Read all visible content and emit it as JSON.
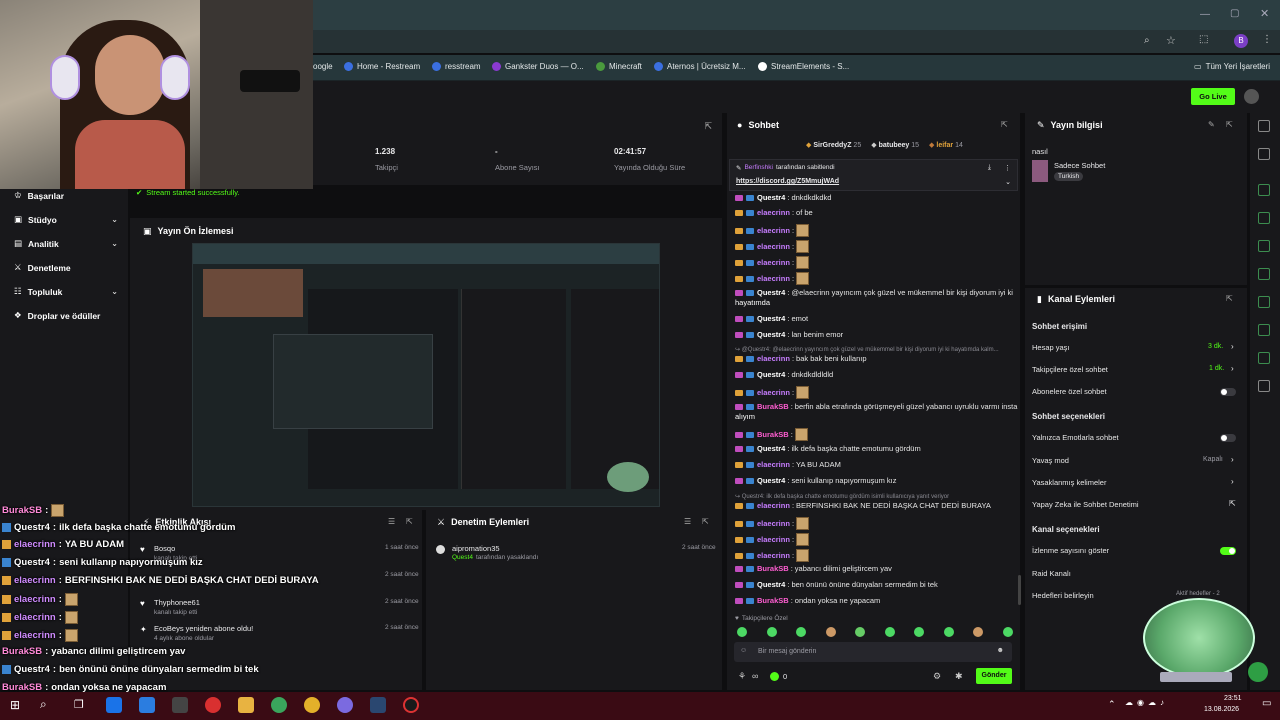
{
  "bookmarks": [
    {
      "label": "oogle",
      "color": "#888"
    },
    {
      "label": "Home - Restream",
      "color": "#3b6fe0"
    },
    {
      "label": "resstream",
      "color": "#3b6fe0"
    },
    {
      "label": "Gankster Duos — O...",
      "color": "#8a3ad1"
    },
    {
      "label": "Minecraft",
      "color": "#4a9a3d"
    },
    {
      "label": "Aternos | Ücretsiz M...",
      "color": "#3b6fe0"
    },
    {
      "label": "StreamElements - S...",
      "color": "#ffffff"
    }
  ],
  "all_bookmarks": "Tüm Yeri İşaretleri",
  "go_live": "Go Live",
  "stats": [
    {
      "value": "1.238",
      "label": "Takipçi"
    },
    {
      "value": "-",
      "label": "Abone Sayısı"
    },
    {
      "value": "02:41:57",
      "label": "Yayında Olduğu Süre"
    }
  ],
  "stream_status": "Stream started successfully.",
  "nav": [
    "Başarılar",
    "Stüdyo",
    "Analitik",
    "Denetleme",
    "Topluluk",
    "Droplar ve ödüller"
  ],
  "preview_title": "Yayın Ön İzlemesi",
  "activity": {
    "title": "Etkinlik Akışı",
    "items": [
      {
        "name": "Bosqo",
        "sub": "kanalı takip etti",
        "time": "1 saat önce"
      },
      {
        "name": "",
        "sub": "",
        "time": "2 saat önce"
      },
      {
        "name": "Thyphonee61",
        "sub": "kanalı takip etti",
        "time": "2 saat önce"
      },
      {
        "name": "EcoBeys yeniden abone oldu!",
        "sub": "4 aylık abone oldular",
        "time": "2 saat önce"
      }
    ]
  },
  "moderation": {
    "title": "Denetim Eylemleri",
    "item_name": "aipromation35",
    "item_by": "Quest4",
    "item_action": "tarafından yasaklandı",
    "item_time": "2 saat önce"
  },
  "chat": {
    "title": "Sohbet",
    "leaders": [
      {
        "name": "SirGreddyZ",
        "score": "25"
      },
      {
        "name": "batubeey",
        "score": "15"
      },
      {
        "name": "leifar",
        "score": "14"
      }
    ],
    "pinned_by": "Berfinshki",
    "pinned_suffix": "tarafından sabitlendi",
    "pinned_link": "https://discord.gg/Z5MmujWAd",
    "messages": [
      {
        "user": "Questr4",
        "text": "dnkdkdkdkd",
        "color": "#fff",
        "badge": "p"
      },
      {
        "user": "elaecrinn",
        "text": "of be",
        "color": "#c77dff",
        "badge": "c"
      },
      {
        "user": "elaecrinn",
        "text": "",
        "emote": true,
        "color": "#c77dff",
        "badge": "c"
      },
      {
        "user": "elaecrinn",
        "text": "",
        "emote": true,
        "color": "#c77dff",
        "badge": "c"
      },
      {
        "user": "elaecrinn",
        "text": "",
        "emote": true,
        "color": "#c77dff",
        "badge": "c"
      },
      {
        "user": "elaecrinn",
        "text": "",
        "emote": true,
        "color": "#c77dff",
        "badge": "c"
      },
      {
        "user": "Questr4",
        "text": "@elaecrinn yayıncım çok güzel ve mükemmel bir kişi diyorum iyi ki",
        "color": "#fff",
        "badge": "p"
      },
      {
        "user": "",
        "text": "hayatımda",
        "color": "#fff",
        "badge": ""
      },
      {
        "user": "Questr4",
        "text": "emot",
        "color": "#fff",
        "badge": "p"
      },
      {
        "user": "Questr4",
        "text": "lan benim emor",
        "color": "#fff",
        "badge": "p"
      },
      {
        "user": "",
        "text": "↪ @Questr4: @elaecrinn yayıncım çok güzel ve mükemmel bir kişi diyorum iyi ki hayatımda kalm...",
        "color": "#8a8a92",
        "badge": ""
      },
      {
        "user": "elaecrinn",
        "text": "bak bak beni kullanıp",
        "color": "#c77dff",
        "badge": "c"
      },
      {
        "user": "Questr4",
        "text": "dnkdkdldldld",
        "color": "#fff",
        "badge": "p"
      },
      {
        "user": "elaecrinn",
        "text": "",
        "emote": true,
        "color": "#c77dff",
        "badge": "c"
      },
      {
        "user": "BurakSB",
        "text": "berfin abla etrafında görüşmeyeli güzel yabancı uyruklu varmı insta",
        "color": "#ff5ed2",
        "badge": "p"
      },
      {
        "user": "",
        "text": "alıyım",
        "color": "#fff",
        "badge": ""
      },
      {
        "user": "BurakSB",
        "text": "",
        "emote": true,
        "color": "#ff5ed2",
        "badge": "p"
      },
      {
        "user": "Questr4",
        "text": "ilk defa başka chatte emotumu gördüm",
        "color": "#fff",
        "badge": "p"
      },
      {
        "user": "elaecrinn",
        "text": "YA BU ADAM",
        "color": "#c77dff",
        "badge": "c"
      },
      {
        "user": "Questr4",
        "text": "seni kullanıp napıyormuşum kız",
        "color": "#fff",
        "badge": "p"
      },
      {
        "user": "",
        "text": "↪ Questr4: ilk defa başka chatte emotumu gördüm isimli kullanıcıya yanıt veriyor",
        "color": "#8a8a92",
        "badge": ""
      },
      {
        "user": "elaecrinn",
        "text": "BERFINSHKI BAK NE DEDİ BAŞKA CHAT DEDİ BURAYA",
        "color": "#c77dff",
        "badge": "c"
      },
      {
        "user": "elaecrinn",
        "text": "",
        "emote": true,
        "color": "#c77dff",
        "badge": "c"
      },
      {
        "user": "elaecrinn",
        "text": "",
        "emote": true,
        "color": "#c77dff",
        "badge": "c"
      },
      {
        "user": "elaecrinn",
        "text": "",
        "emote": true,
        "color": "#c77dff",
        "badge": "c"
      },
      {
        "user": "BurakSB",
        "text": "yabancı dilimi geliştircem yav",
        "color": "#ff5ed2",
        "badge": "p"
      },
      {
        "user": "Questr4",
        "text": "ben önünü önüne dünyaları sermedim bi tek",
        "color": "#fff",
        "badge": "p"
      },
      {
        "user": "BurakSB",
        "text": "ondan yoksa ne yapacam",
        "color": "#ff5ed2",
        "badge": "p"
      }
    ],
    "followers_only": "Takipçilere Özel",
    "placeholder": "Bir mesaj gönderin",
    "points": "0",
    "send": "Gönder"
  },
  "stream_info": {
    "title": "Yayın bilgisi",
    "name": "nasıl",
    "category": "Sadece Sohbet",
    "tag": "Turkish"
  },
  "channel_actions": {
    "title": "Kanal Eylemleri",
    "section1": "Sohbet erişimi",
    "rows1": [
      {
        "label": "Hesap yaşı",
        "value": "3 dk."
      },
      {
        "label": "Takipçilere özel sohbet",
        "value": "1 dk."
      },
      {
        "label": "Abonelere özel sohbet",
        "value": ""
      }
    ],
    "section2": "Sohbet seçenekleri",
    "rows2": [
      {
        "label": "Yalnızca Emotlarla sohbet",
        "value": ""
      },
      {
        "label": "Yavaş mod",
        "value": "Kapalı"
      },
      {
        "label": "Yasaklanmış kelimeler",
        "value": ""
      },
      {
        "label": "Yapay Zeka ile Sohbet Denetimi",
        "value": ""
      }
    ],
    "section3": "Kanal seçenekleri",
    "rows3": [
      {
        "label": "İzlenme sayısını göster",
        "value": ""
      },
      {
        "label": "Raid Kanalı",
        "value": ""
      },
      {
        "label": "Hedefleri belirleyin",
        "value": "Aktif hedefler - 2"
      }
    ]
  },
  "overlay_chat": [
    {
      "user": "BurakSB",
      "text": "",
      "emote": true,
      "color": "#ff8ad8",
      "badge": "#c04dbd"
    },
    {
      "user": "Questr4",
      "text": "ilk defa başka chatte emotumu gördüm",
      "color": "#ffffff",
      "badge": "#3a84cf"
    },
    {
      "user": "elaecrinn",
      "text": "YA BU ADAM",
      "color": "#d08cff",
      "badge": "#e0a23a"
    },
    {
      "user": "Questr4",
      "text": "seni kullanıp napıyormuşum kız",
      "color": "#ffffff",
      "badge": "#3a84cf"
    },
    {
      "user": "elaecrinn",
      "text": "BERFINSHKI BAK NE DEDİ BAŞKA CHAT DEDİ BURAYA",
      "color": "#d08cff",
      "badge": "#e0a23a"
    },
    {
      "user": "elaecrinn",
      "text": "",
      "emote": true,
      "color": "#d08cff",
      "badge": "#e0a23a"
    },
    {
      "user": "elaecrinn",
      "text": "",
      "emote": true,
      "color": "#d08cff",
      "badge": "#e0a23a"
    },
    {
      "user": "elaecrinn",
      "text": "",
      "emote": true,
      "color": "#d08cff",
      "badge": "#e0a23a"
    },
    {
      "user": "BurakSB",
      "text": "yabancı dilimi geliştircem yav",
      "color": "#ff8ad8",
      "badge": "#c04dbd"
    },
    {
      "user": "Questr4",
      "text": "ben önünü önüne dünyaları sermedim bi tek",
      "color": "#ffffff",
      "badge": "#3a84cf"
    },
    {
      "user": "BurakSB",
      "text": "ondan yoksa ne yapacam",
      "color": "#ff8ad8",
      "badge": "#c04dbd"
    }
  ],
  "taskbar": {
    "time": "23:51",
    "date": "13.08.2026"
  },
  "colors": {
    "accent": "#53fc18",
    "bg": "#0e0e10",
    "panel": "#18181b",
    "taskbar": "#3a0b14"
  }
}
